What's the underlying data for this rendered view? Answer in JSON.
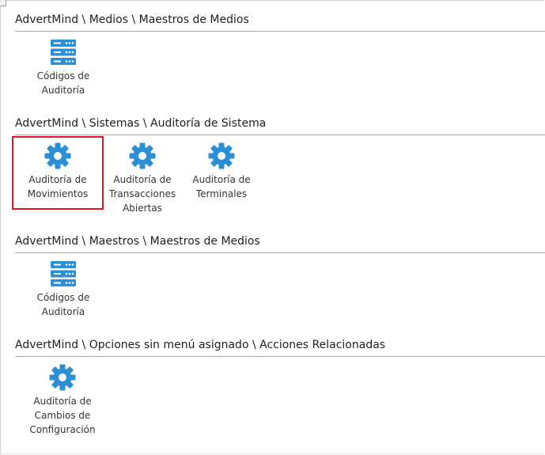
{
  "colors": {
    "icon_blue": "#2b8fd6",
    "selection_red": "#e8141b",
    "divider": "#a9a9a9"
  },
  "sections": [
    {
      "title": "AdvertMind \\ Medios \\ Maestros de Medios",
      "items": [
        {
          "icon": "database-icon",
          "label_lines": [
            "Códigos de",
            "Auditoría"
          ]
        }
      ]
    },
    {
      "title": "AdvertMind \\ Sistemas \\ Auditoría de Sistema",
      "items": [
        {
          "icon": "gear-icon",
          "label_lines": [
            "Auditoría de",
            "Movimientos"
          ],
          "selected": true
        },
        {
          "icon": "gear-icon",
          "label_lines": [
            "Auditoría de",
            "Transacciones",
            "Abiertas"
          ]
        },
        {
          "icon": "gear-icon",
          "label_lines": [
            "Auditoría de",
            "Terminales"
          ]
        }
      ]
    },
    {
      "title": "AdvertMind \\ Maestros \\ Maestros de Medios",
      "items": [
        {
          "icon": "database-icon",
          "label_lines": [
            "Códigos de",
            "Auditoría"
          ]
        }
      ]
    },
    {
      "title": "AdvertMind \\ Opciones sin menú asignado \\ Acciones Relacionadas",
      "items": [
        {
          "icon": "gear-icon",
          "label_lines": [
            "Auditoría de",
            "Cambios de",
            "Configuración"
          ]
        }
      ]
    }
  ]
}
